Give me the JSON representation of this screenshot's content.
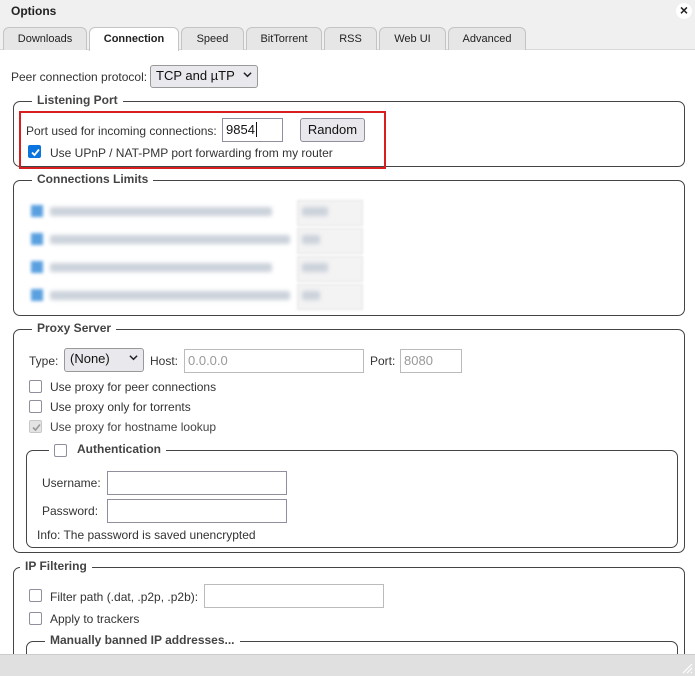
{
  "window": {
    "title": "Options"
  },
  "tabs": [
    {
      "label": "Downloads"
    },
    {
      "label": "Connection"
    },
    {
      "label": "Speed"
    },
    {
      "label": "BitTorrent"
    },
    {
      "label": "RSS"
    },
    {
      "label": "Web UI"
    },
    {
      "label": "Advanced"
    }
  ],
  "active_tab": "Connection",
  "peer_protocol": {
    "label": "Peer connection protocol:",
    "value": "TCP and µTP"
  },
  "listening_port": {
    "legend": "Listening Port",
    "port_label": "Port used for incoming connections:",
    "port_value": "9854",
    "random_button": "Random",
    "upnp_label": "Use UPnP / NAT-PMP port forwarding from my router",
    "upnp_checked": true
  },
  "connection_limits": {
    "legend": "Connections Limits"
  },
  "proxy": {
    "legend": "Proxy Server",
    "type_label": "Type:",
    "type_value": "(None)",
    "host_label": "Host:",
    "host_placeholder": "0.0.0.0",
    "port_label": "Port:",
    "port_placeholder": "8080",
    "peer_conn_label": "Use proxy for peer connections",
    "only_torrents_label": "Use proxy only for torrents",
    "hostname_lookup_label": "Use proxy for hostname lookup",
    "auth": {
      "legend": "Authentication",
      "username_label": "Username:",
      "password_label": "Password:",
      "info": "Info: The password is saved unencrypted"
    }
  },
  "ip_filtering": {
    "legend": "IP Filtering",
    "filter_path_label": "Filter path (.dat, .p2p, .p2b):",
    "apply_trackers_label": "Apply to trackers",
    "banned_legend": "Manually banned IP addresses..."
  },
  "colors": {
    "accent": "#0b74de",
    "highlight": "#d81e1e"
  }
}
